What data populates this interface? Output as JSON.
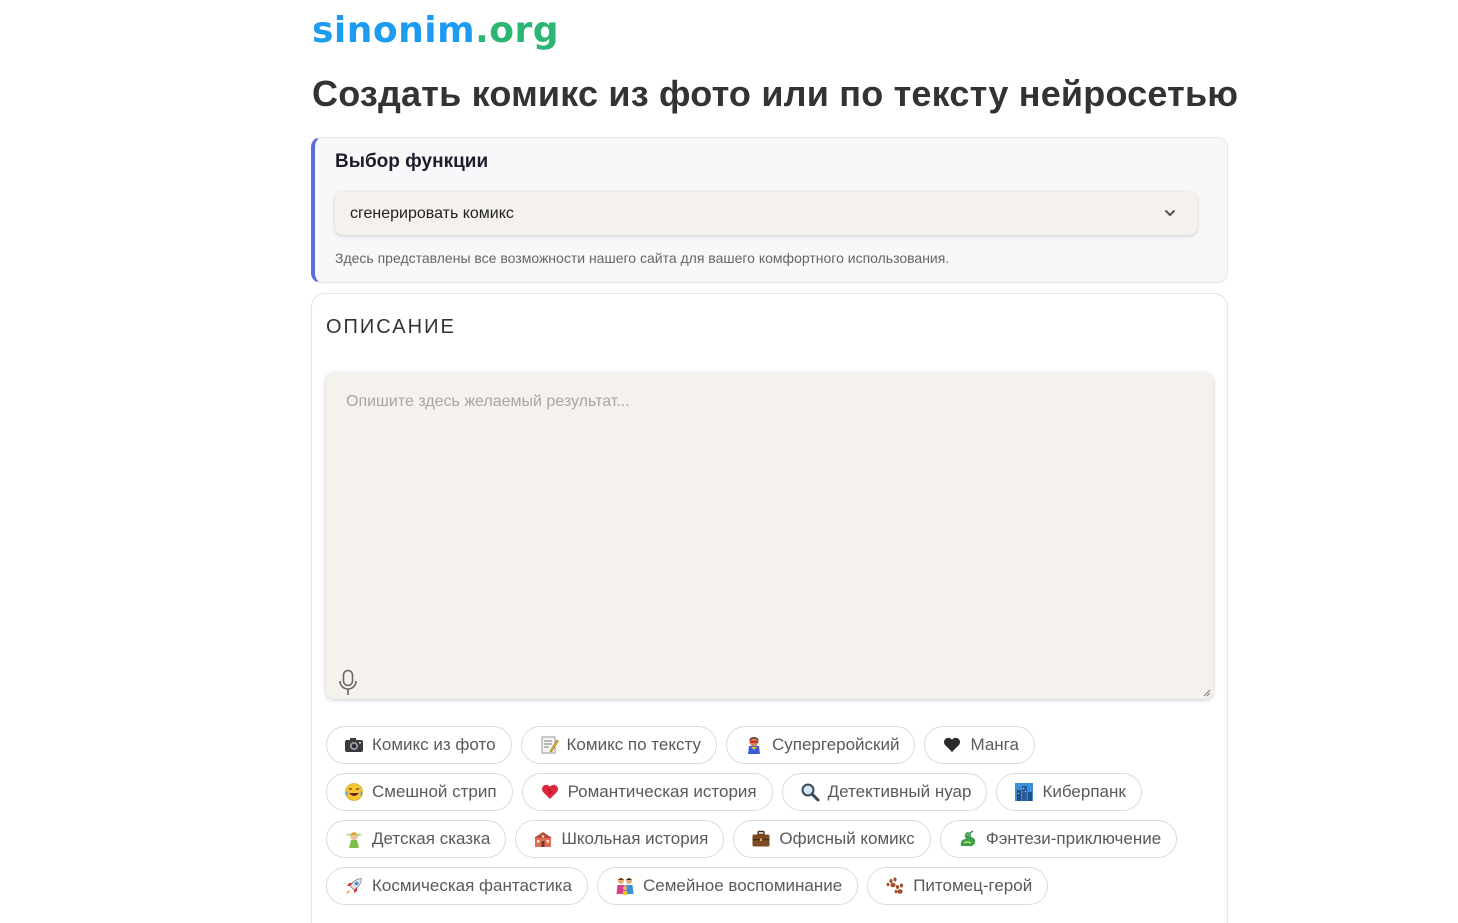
{
  "site": {
    "logo_part1": "sinonim",
    "logo_part2": ".org"
  },
  "page": {
    "title": "Создать комикс из фото или по тексту нейросетью"
  },
  "function_select": {
    "heading": "Выбор функции",
    "selected": "сгенерировать комикс",
    "hint": "Здесь представлены все возможности нашего сайта для вашего комфортного использования."
  },
  "description": {
    "label": "ОПИСАНИЕ",
    "placeholder": "Опишите здесь желаемый результат..."
  },
  "chips": [
    [
      {
        "label": "Комикс из фото",
        "icon": "camera-icon"
      },
      {
        "label": "Комикс по тексту",
        "icon": "memo-icon"
      },
      {
        "label": "Супергеройский",
        "icon": "superhero-icon"
      },
      {
        "label": "Манга",
        "icon": "black-heart-icon"
      }
    ],
    [
      {
        "label": "Смешной стрип",
        "icon": "laughing-face-icon"
      },
      {
        "label": "Романтическая история",
        "icon": "red-heart-icon"
      },
      {
        "label": "Детективный нуар",
        "icon": "magnifier-icon"
      },
      {
        "label": "Киберпанк",
        "icon": "city-icon"
      }
    ],
    [
      {
        "label": "Детская сказка",
        "icon": "fairy-icon"
      },
      {
        "label": "Школьная история",
        "icon": "school-icon"
      },
      {
        "label": "Офисный комикс",
        "icon": "briefcase-icon"
      },
      {
        "label": "Фэнтези-приключение",
        "icon": "dragon-icon"
      }
    ],
    [
      {
        "label": "Космическая фантастика",
        "icon": "rocket-icon"
      },
      {
        "label": "Семейное воспоминание",
        "icon": "family-icon"
      },
      {
        "label": "Питомец-герой",
        "icon": "paw-icon"
      }
    ]
  ],
  "colors": {
    "accent": "#5b6ee1",
    "logo_blue": "#1d9bf0",
    "logo_green": "#2bb673",
    "field_bg": "#f5f2ed"
  }
}
